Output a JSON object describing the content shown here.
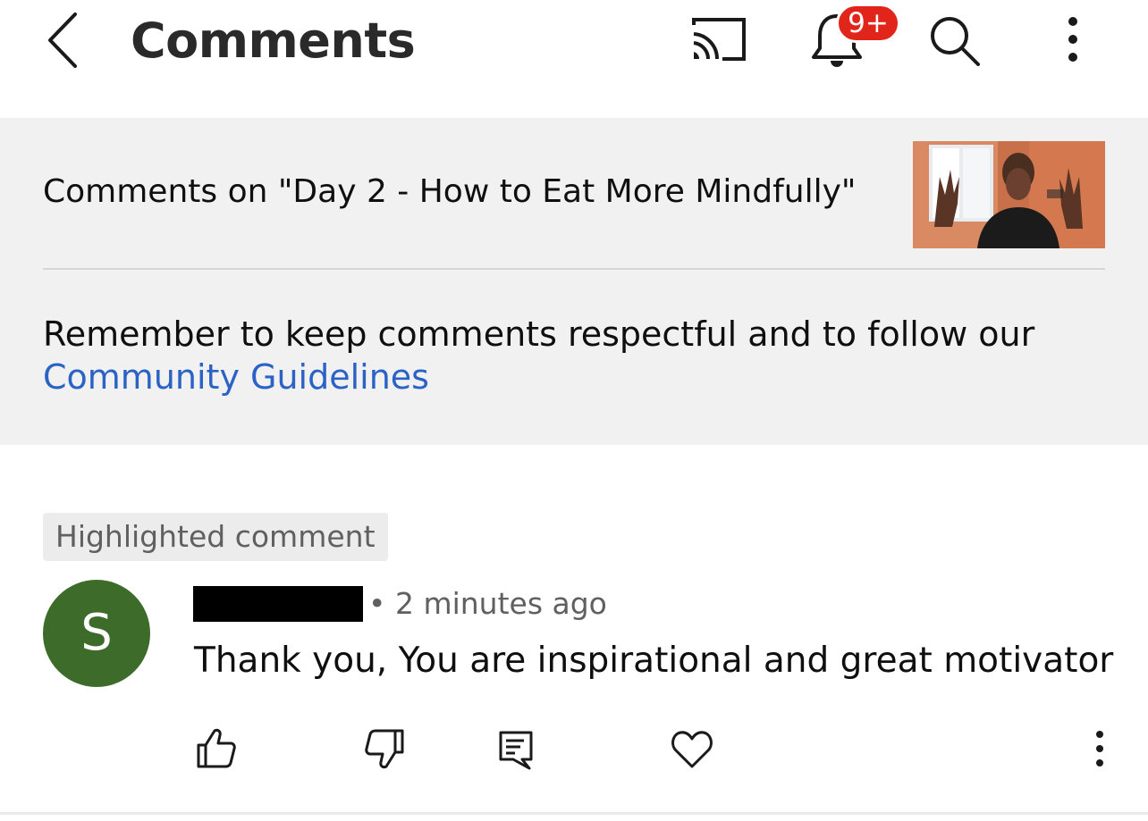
{
  "header": {
    "title": "Comments",
    "notification_badge": "9+",
    "icons": [
      "back-arrow-icon",
      "cast-icon",
      "bell-icon",
      "search-icon",
      "more-vertical-icon"
    ]
  },
  "info_panel": {
    "comments_on": "Comments on \"Day 2 - How to Eat More Mindfully\"",
    "reminder_text": "Remember to keep comments respectful and to follow our",
    "guidelines_link": "Community Guidelines"
  },
  "comment": {
    "highlight_label": "Highlighted comment",
    "avatar_initial": "S",
    "timestamp": "• 2 minutes ago",
    "text": "Thank you, You are inspirational and great motivator",
    "actions": [
      "thumb-up-icon",
      "thumb-down-icon",
      "reply-icon",
      "heart-icon",
      "more-vertical-icon"
    ]
  },
  "colors": {
    "badge": "#e1251b",
    "link": "#2a63c5",
    "avatar": "#3d6b2a",
    "panel": "#f1f1f1"
  }
}
